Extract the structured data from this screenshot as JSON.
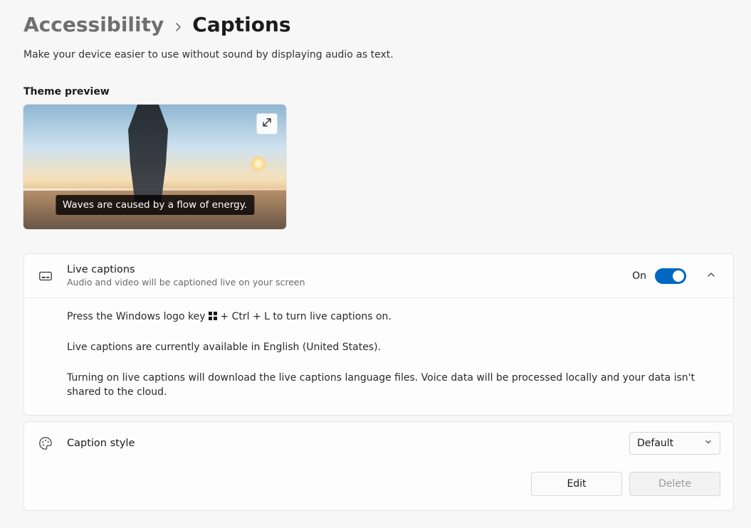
{
  "breadcrumb": {
    "parent": "Accessibility",
    "current": "Captions"
  },
  "subtitle": "Make your device easier to use without sound by displaying audio as text.",
  "theme_preview": {
    "label": "Theme preview",
    "sample_caption": "Waves are caused by a flow of energy."
  },
  "live_captions": {
    "title": "Live captions",
    "subtitle": "Audio and video will be captioned live on your screen",
    "toggle_state_label": "On",
    "toggle_on": true,
    "shortcut_line_pre": "Press the Windows logo key ",
    "shortcut_line_post": " + Ctrl + L to turn live captions on.",
    "availability_line": "Live captions are currently available in English (United States).",
    "download_line": "Turning on live captions will download the live captions language files. Voice data will be processed locally and your data isn't shared to the cloud."
  },
  "caption_style": {
    "title": "Caption style",
    "selected": "Default",
    "edit_label": "Edit",
    "delete_label": "Delete",
    "delete_disabled": true
  }
}
